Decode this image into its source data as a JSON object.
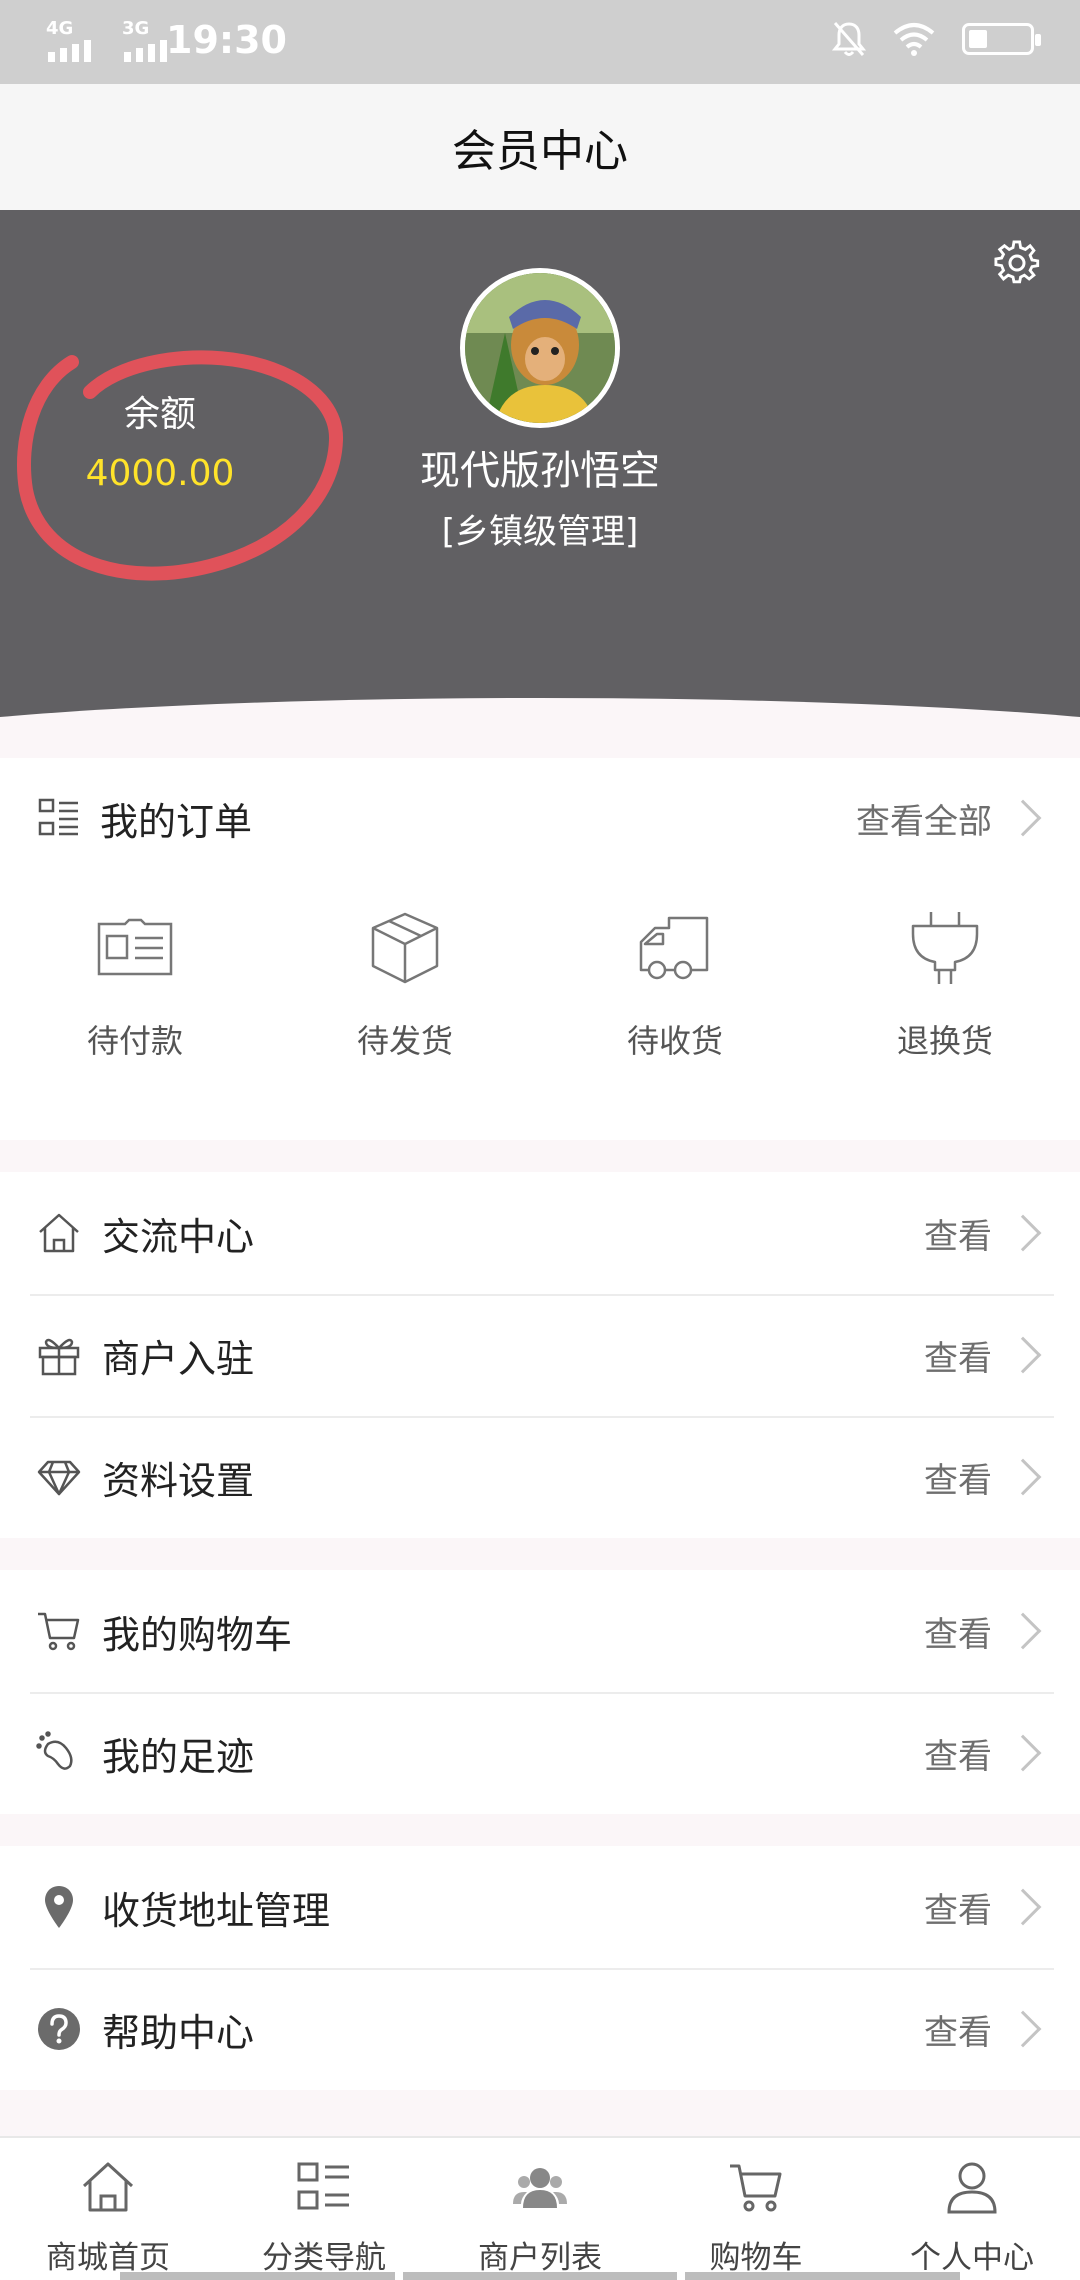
{
  "status_bar": {
    "time": "19:30",
    "net1": "4G",
    "net2": "3G"
  },
  "header": {
    "title": "会员中心"
  },
  "profile": {
    "balance_label": "余额",
    "balance_value": "4000.00",
    "username": "现代版孙悟空",
    "level": "[乡镇级管理]"
  },
  "orders": {
    "title": "我的订单",
    "view_all": "查看全部",
    "items": [
      {
        "label": "待付款",
        "icon": "id-card-icon"
      },
      {
        "label": "待发货",
        "icon": "box-icon"
      },
      {
        "label": "待收货",
        "icon": "truck-icon"
      },
      {
        "label": "退换货",
        "icon": "plug-icon"
      }
    ]
  },
  "menu": {
    "view": "查看",
    "group1": [
      {
        "label": "交流中心",
        "icon": "home-icon"
      },
      {
        "label": "商户入驻",
        "icon": "gift-icon"
      },
      {
        "label": "资料设置",
        "icon": "diamond-icon"
      }
    ],
    "group2": [
      {
        "label": "我的购物车",
        "icon": "cart-icon"
      },
      {
        "label": "我的足迹",
        "icon": "footprint-icon"
      }
    ],
    "group3": [
      {
        "label": "收货地址管理",
        "icon": "location-icon"
      },
      {
        "label": "帮助中心",
        "icon": "help-icon"
      }
    ]
  },
  "tabbar": [
    {
      "label": "商城首页",
      "icon": "home-icon"
    },
    {
      "label": "分类导航",
      "icon": "grid-list-icon"
    },
    {
      "label": "商户列表",
      "icon": "users-icon"
    },
    {
      "label": "购物车",
      "icon": "cart-icon"
    },
    {
      "label": "个人中心",
      "icon": "person-icon"
    }
  ],
  "colors": {
    "hero_bg": "#616063",
    "balance": "#ffe32a",
    "annotation": "#e0525a"
  }
}
